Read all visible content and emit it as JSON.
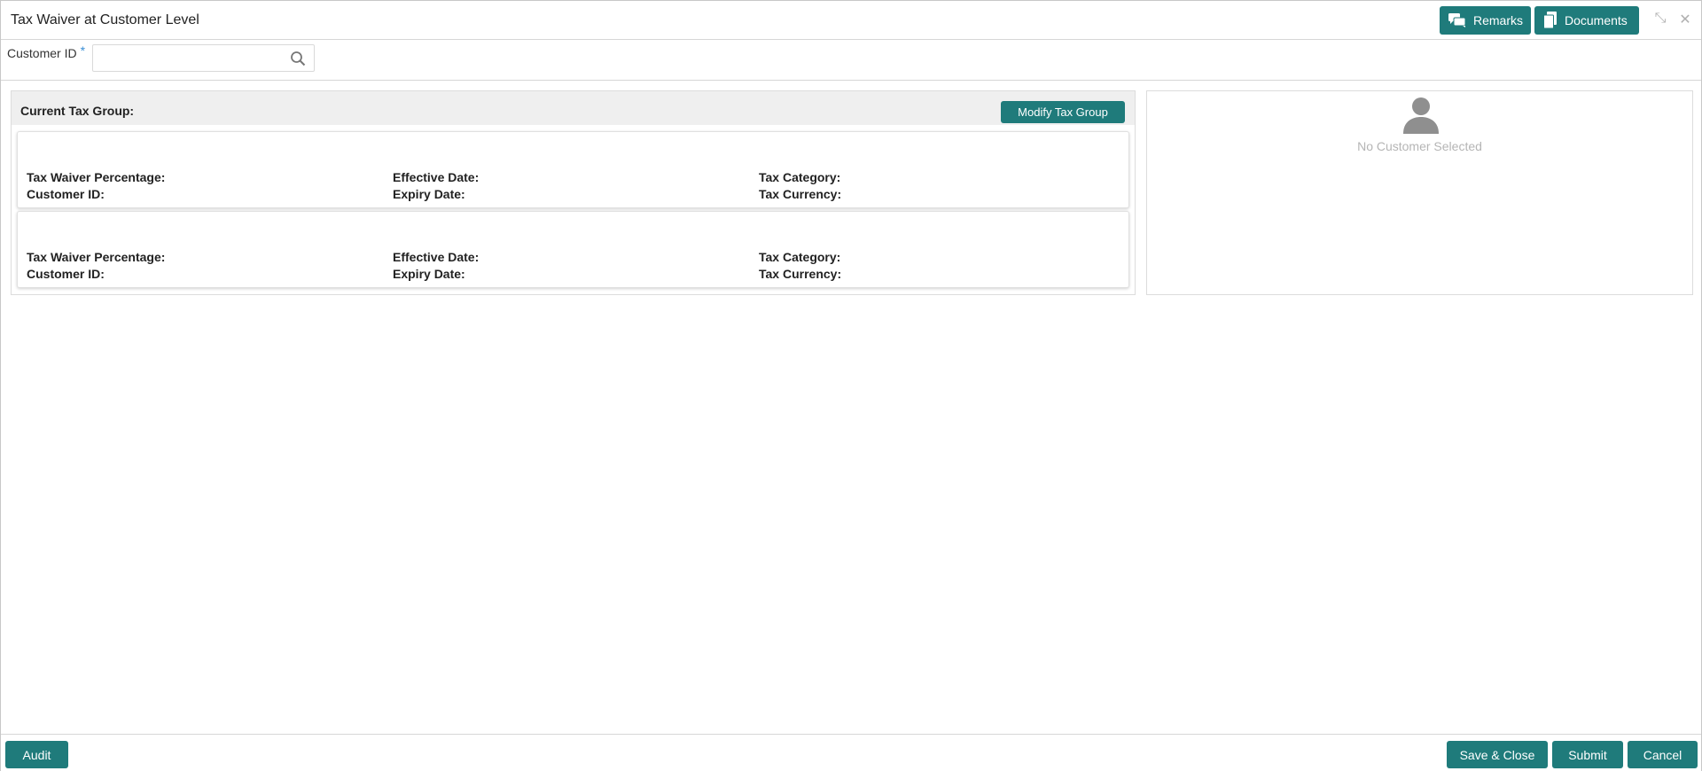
{
  "header": {
    "title": "Tax Waiver at Customer Level",
    "remarks_label": "Remarks",
    "documents_label": "Documents",
    "minimize_glyph": "⤡",
    "close_glyph": "✕"
  },
  "customer": {
    "label": "Customer ID",
    "required_mark": "*",
    "value": "",
    "placeholder": ""
  },
  "tax_group": {
    "title": "Current Tax Group:",
    "modify_label": "Modify Tax Group",
    "cards": [
      {
        "tax_waiver_percentage": "Tax Waiver Percentage:",
        "customer_id": "Customer ID:",
        "effective_date": "Effective Date:",
        "expiry_date": "Expiry Date:",
        "tax_category": "Tax Category:",
        "tax_currency": "Tax Currency:"
      },
      {
        "tax_waiver_percentage": "Tax Waiver Percentage:",
        "customer_id": "Customer ID:",
        "effective_date": "Effective Date:",
        "expiry_date": "Expiry Date:",
        "tax_category": "Tax Category:",
        "tax_currency": "Tax Currency:"
      }
    ]
  },
  "customer_panel": {
    "empty_text": "No Customer Selected"
  },
  "footer": {
    "audit_label": "Audit",
    "save_close_label": "Save & Close",
    "submit_label": "Submit",
    "cancel_label": "Cancel"
  },
  "colors": {
    "accent": "#1f7b7b",
    "required": "#3a8fd6",
    "muted_text": "#b5b5b5"
  }
}
